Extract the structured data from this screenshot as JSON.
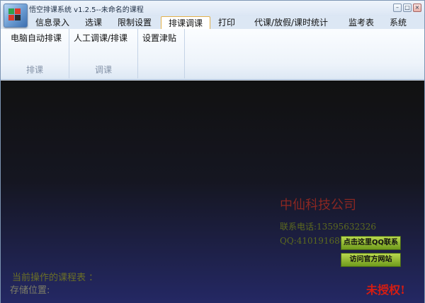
{
  "window": {
    "title": "悟空排课系统 v1.2.5--未命名的课程",
    "buttons": {
      "minimize": "–",
      "maximize": "□",
      "close": "×"
    }
  },
  "menu": {
    "tabs": [
      {
        "label": "信息录入"
      },
      {
        "label": "选课"
      },
      {
        "label": "限制设置"
      },
      {
        "label": "排课调课",
        "active": true
      },
      {
        "label": "打印"
      },
      {
        "label": "代课/放假/课时统计"
      },
      {
        "label": "监考表"
      },
      {
        "label": "系统"
      }
    ]
  },
  "ribbon": {
    "groups": [
      {
        "label": "排课",
        "buttons": [
          "电脑自动排课"
        ]
      },
      {
        "label": "调课",
        "buttons": [
          "人工调课/排课"
        ]
      },
      {
        "label": "",
        "buttons": [
          "设置津贴"
        ]
      }
    ]
  },
  "main": {
    "company": "中仙科技公司",
    "phone": "联系电话:13595632326",
    "qq": "QQ:410191680",
    "qq_button": "点击这里QQ联系",
    "website_button": "访问官方网站",
    "current_table_label": "当前操作的课程表 ：",
    "storage_label": "存储位置:",
    "unlicensed": "未授权!"
  },
  "colors": {
    "active_tab_border": "#e3b14a",
    "company": "#8a2722",
    "contact": "#5d6a1e",
    "button_green": "#8bb52a",
    "unlicensed": "#d51d12"
  }
}
